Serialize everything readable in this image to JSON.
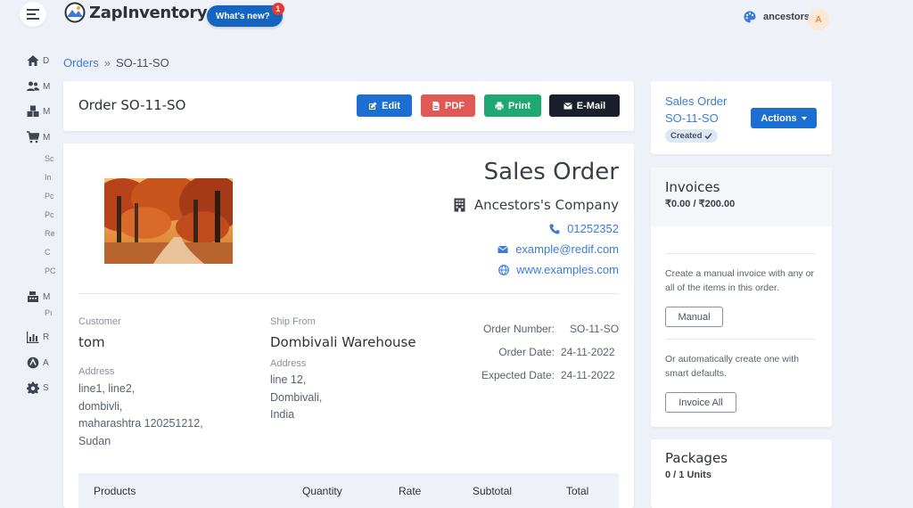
{
  "app": {
    "name": "ZapInventory",
    "whats_new": "What's new?",
    "whats_new_count": "1"
  },
  "user": {
    "name": "ancestors",
    "initial": "A"
  },
  "rail": {
    "items": [
      {
        "icon": "home-icon",
        "label": "D"
      },
      {
        "icon": "users-icon",
        "label": "M"
      },
      {
        "icon": "boxes-icon",
        "label": "M"
      },
      {
        "icon": "cart-icon",
        "label": "M"
      },
      {
        "icon": "register-icon",
        "label": "M"
      },
      {
        "icon": "chart-icon",
        "label": "R"
      },
      {
        "icon": "circle-icon",
        "label": "A"
      },
      {
        "icon": "gear-icon",
        "label": "S"
      }
    ],
    "subitems": [
      "Sc",
      "In",
      "Pc",
      "Pc",
      "Re",
      "C",
      "PC"
    ],
    "extra": "Pı"
  },
  "breadcrumb": {
    "parent": "Orders",
    "separator": "»",
    "current": "SO-11-SO"
  },
  "header": {
    "title": "Order SO-11-SO",
    "edit": "Edit",
    "pdf": "PDF",
    "print": "Print",
    "email": "E-Mail"
  },
  "document": {
    "heading": "Sales Order",
    "company": "Ancestors's Company",
    "phone": "01252352",
    "email": "example@redif.com",
    "website": "www.examples.com",
    "customer": {
      "label": "Customer",
      "name": "tom",
      "address_label": "Address",
      "address_lines": [
        "line1, line2,",
        "dombivli,",
        "maharashtra 120251212,",
        "Sudan"
      ]
    },
    "ship_from": {
      "label": "Ship From",
      "name": "Dombivali Warehouse",
      "address_label": "Address",
      "address_lines": [
        "line 12,",
        "Dombivali,",
        "India"
      ]
    },
    "meta": {
      "order_number_label": "Order Number:",
      "order_number": "SO-11-SO",
      "order_date_label": "Order Date:",
      "order_date": "24-11-2022",
      "expected_date_label": "Expected Date:",
      "expected_date": "24-11-2022"
    },
    "table_headers": [
      "Products",
      "Quantity",
      "Rate",
      "Subtotal",
      "Total"
    ]
  },
  "status": {
    "link_line1": "Sales Order",
    "link_line2": "SO-11-SO",
    "badge": "Created",
    "actions": "Actions"
  },
  "invoices": {
    "title": "Invoices",
    "amount": "₹0.00 / ₹200.00",
    "manual_help": "Create a manual invoice with any or all of the items in this order.",
    "manual_button": "Manual",
    "auto_help": "Or automatically create one with smart defaults.",
    "invoice_all_button": "Invoice All"
  },
  "packages": {
    "title": "Packages",
    "units": "0 / 1 Units"
  }
}
